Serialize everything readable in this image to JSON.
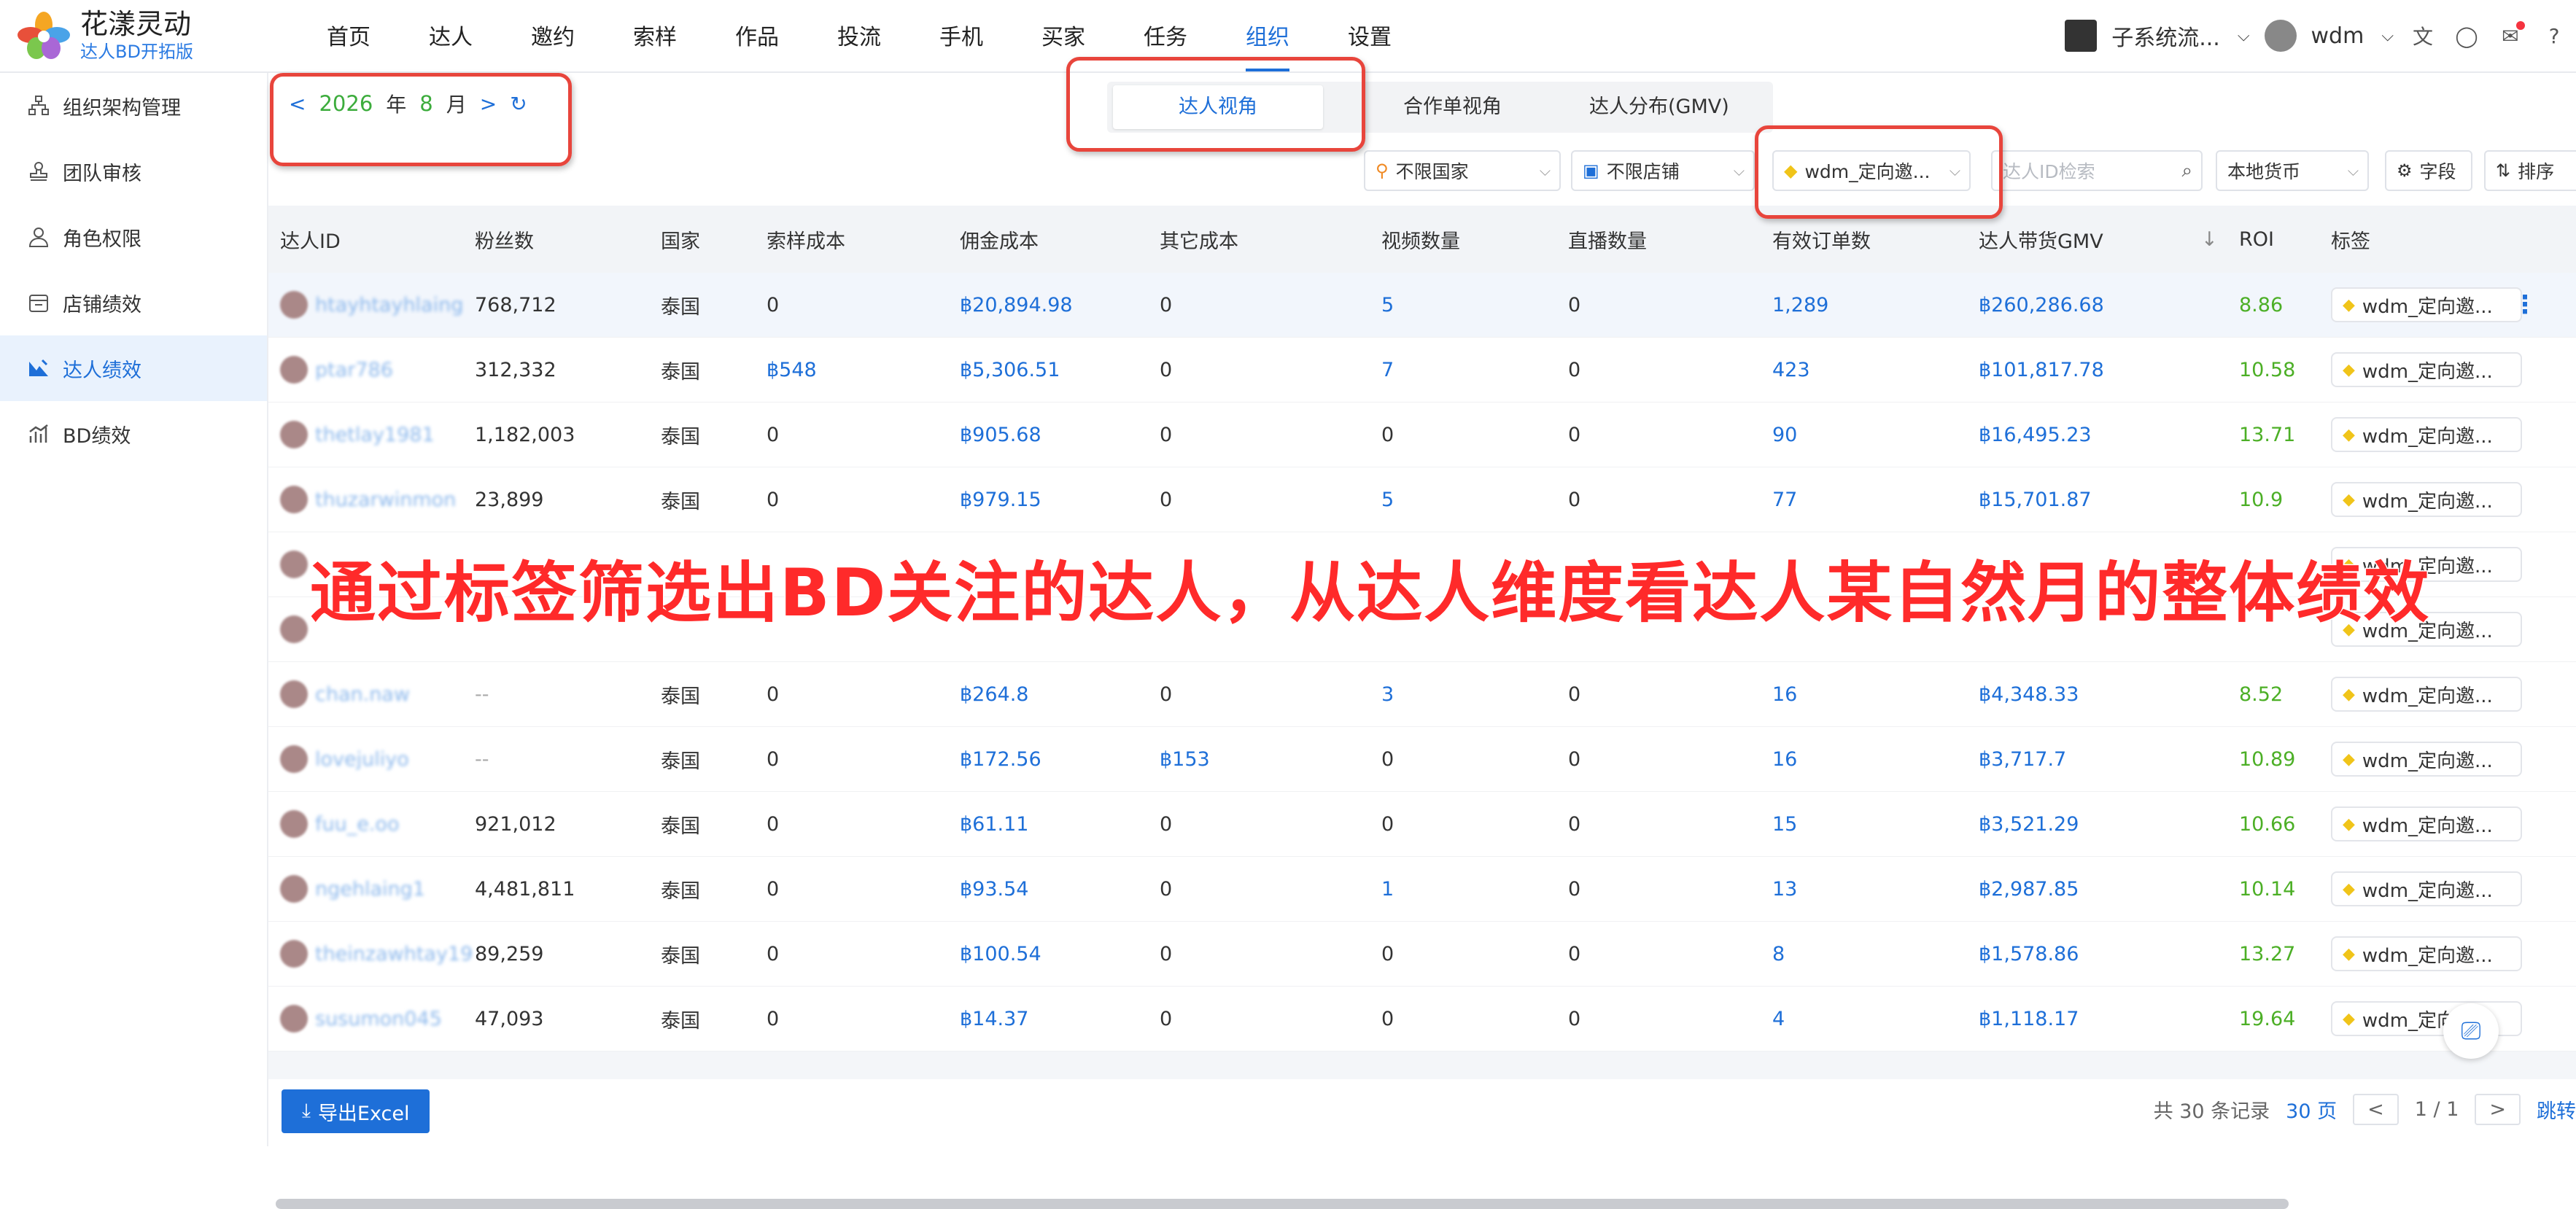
{
  "brand": {
    "name": "花漾灵动",
    "subtitle": "达人BD开拓版"
  },
  "nav": [
    "首页",
    "达人",
    "邀约",
    "索样",
    "作品",
    "投流",
    "手机",
    "买家",
    "任务",
    "组织",
    "设置"
  ],
  "nav_active": "组织",
  "top_right": {
    "system": "子系统流...",
    "user": "wdm"
  },
  "sidebar": [
    {
      "label": "组织架构管理",
      "icon": "org-tree-icon"
    },
    {
      "label": "团队审核",
      "icon": "stamp-icon"
    },
    {
      "label": "角色权限",
      "icon": "user-role-icon"
    },
    {
      "label": "店铺绩效",
      "icon": "shop-icon"
    },
    {
      "label": "达人绩效",
      "icon": "influencer-icon",
      "active": true
    },
    {
      "label": "BD绩效",
      "icon": "bar-chart-icon"
    }
  ],
  "date": {
    "year": "2026",
    "year_unit": "年",
    "month": "8",
    "month_unit": "月"
  },
  "views": [
    "达人视角",
    "合作单视角",
    "达人分布(GMV)"
  ],
  "filters": {
    "country": "不限国家",
    "shop": "不限店铺",
    "tag": "wdm_定向邀...",
    "search_placeholder": "达人ID检索",
    "currency": "本地货币",
    "fields": "字段",
    "sort": "排序"
  },
  "columns": [
    "达人ID",
    "粉丝数",
    "国家",
    "索样成本",
    "佣金成本",
    "其它成本",
    "视频数量",
    "直播数量",
    "有效订单数",
    "达人带货GMV",
    "ROI",
    "标签"
  ],
  "rows": [
    {
      "id": "htayhtayhlaing",
      "fans": "768,712",
      "country": "泰国",
      "sample": "0",
      "commission": "฿20,894.98",
      "other": "0",
      "videos": "5",
      "live": "0",
      "orders": "1,289",
      "gmv": "฿260,286.68",
      "roi": "8.86",
      "tag": "wdm_定向邀..."
    },
    {
      "id": "ptar786",
      "fans": "312,332",
      "country": "泰国",
      "sample": "฿548",
      "commission": "฿5,306.51",
      "other": "0",
      "videos": "7",
      "live": "0",
      "orders": "423",
      "gmv": "฿101,817.78",
      "roi": "10.58",
      "tag": "wdm_定向邀..."
    },
    {
      "id": "thetlay1981",
      "fans": "1,182,003",
      "country": "泰国",
      "sample": "0",
      "commission": "฿905.68",
      "other": "0",
      "videos": "0",
      "live": "0",
      "orders": "90",
      "gmv": "฿16,495.23",
      "roi": "13.71",
      "tag": "wdm_定向邀..."
    },
    {
      "id": "thuzarwinmon",
      "fans": "23,899",
      "country": "泰国",
      "sample": "0",
      "commission": "฿979.15",
      "other": "0",
      "videos": "5",
      "live": "0",
      "orders": "77",
      "gmv": "฿15,701.87",
      "roi": "10.9",
      "tag": "wdm_定向邀..."
    },
    {
      "id": "",
      "fans": "",
      "country": "",
      "sample": "",
      "commission": "",
      "other": "",
      "videos": "",
      "live": "",
      "orders": "",
      "gmv": "",
      "roi": "",
      "tag": "wdm_定向邀..."
    },
    {
      "id": "",
      "fans": "",
      "country": "",
      "sample": "",
      "commission": "",
      "other": "",
      "videos": "",
      "live": "",
      "orders": "",
      "gmv": "",
      "roi": "",
      "tag": "wdm_定向邀..."
    },
    {
      "id": "chan.naw",
      "fans": "--",
      "country": "泰国",
      "sample": "0",
      "commission": "฿264.8",
      "other": "0",
      "videos": "3",
      "live": "0",
      "orders": "16",
      "gmv": "฿4,348.33",
      "roi": "8.52",
      "tag": "wdm_定向邀..."
    },
    {
      "id": "lovejuliyo",
      "fans": "--",
      "country": "泰国",
      "sample": "0",
      "commission": "฿172.56",
      "other": "฿153",
      "videos": "0",
      "live": "0",
      "orders": "16",
      "gmv": "฿3,717.7",
      "roi": "10.89",
      "tag": "wdm_定向邀..."
    },
    {
      "id": "fuu_e.oo",
      "fans": "921,012",
      "country": "泰国",
      "sample": "0",
      "commission": "฿61.11",
      "other": "0",
      "videos": "0",
      "live": "0",
      "orders": "15",
      "gmv": "฿3,521.29",
      "roi": "10.66",
      "tag": "wdm_定向邀..."
    },
    {
      "id": "ngehlaing1",
      "fans": "4,481,811",
      "country": "泰国",
      "sample": "0",
      "commission": "฿93.54",
      "other": "0",
      "videos": "1",
      "live": "0",
      "orders": "13",
      "gmv": "฿2,987.85",
      "roi": "10.14",
      "tag": "wdm_定向邀..."
    },
    {
      "id": "theinzawhtay19",
      "fans": "89,259",
      "country": "泰国",
      "sample": "0",
      "commission": "฿100.54",
      "other": "0",
      "videos": "0",
      "live": "0",
      "orders": "8",
      "gmv": "฿1,578.86",
      "roi": "13.27",
      "tag": "wdm_定向邀..."
    },
    {
      "id": "susumon045",
      "fans": "47,093",
      "country": "泰国",
      "sample": "0",
      "commission": "฿14.37",
      "other": "0",
      "videos": "0",
      "live": "0",
      "orders": "4",
      "gmv": "฿1,118.17",
      "roi": "19.64",
      "tag": "wdm_定向邀..."
    }
  ],
  "annotation": "通过标签筛选出BD关注的达人，从达人维度看达人某自然月的整体绩效",
  "footer": {
    "export": "导出Excel",
    "total": "共 30 条记录",
    "page_size": "30",
    "page_unit": "页",
    "page": "1 / 1",
    "jump": "跳转"
  }
}
